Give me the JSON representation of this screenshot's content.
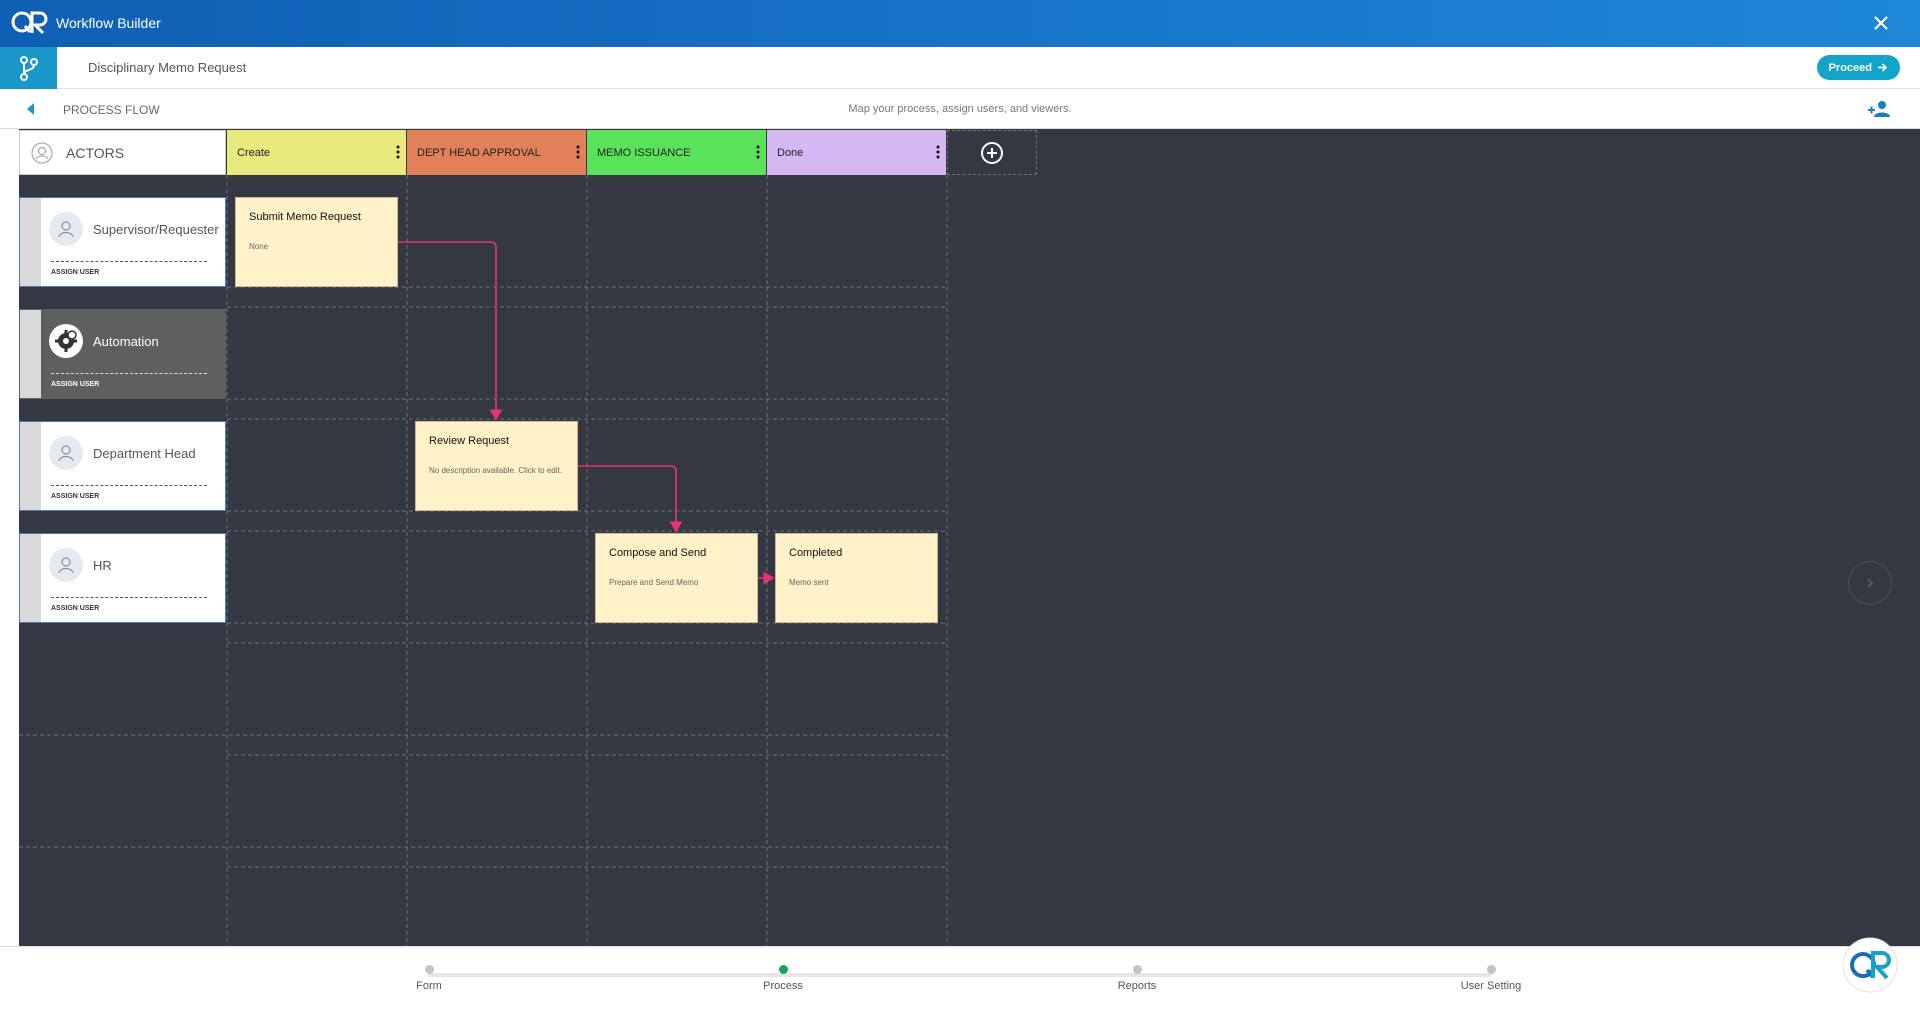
{
  "app": {
    "title": "Workflow Builder"
  },
  "header": {
    "document_title": "Disciplinary Memo Request",
    "proceed_label": "Proceed"
  },
  "subheader": {
    "section": "PROCESS FLOW",
    "hint": "Map your process, assign users, and viewers."
  },
  "lanes": {
    "actors_label": "ACTORS",
    "columns": [
      {
        "label": "Create",
        "color": "#e9ea7d"
      },
      {
        "label": "DEPT HEAD APPROVAL",
        "color": "#e2805a"
      },
      {
        "label": "MEMO ISSUANCE",
        "color": "#5be25b"
      },
      {
        "label": "Done",
        "color": "#d4b8f2"
      }
    ]
  },
  "actors": [
    {
      "name": "Supervisor/Requester",
      "assign_label": "ASSIGN USER"
    },
    {
      "name": "Automation",
      "assign_label": "ASSIGN USER"
    },
    {
      "name": "Department Head",
      "assign_label": "ASSIGN USER"
    },
    {
      "name": "HR",
      "assign_label": "ASSIGN USER"
    }
  ],
  "nodes": [
    {
      "title": "Submit Memo Request",
      "description": "None"
    },
    {
      "title": "Review Request",
      "description": "No description available. Click to edit."
    },
    {
      "title": "Compose and Send",
      "description": "Prepare and Send Memo"
    },
    {
      "title": "Completed",
      "description": "Memo sent"
    }
  ],
  "connector_color": "#e8336e",
  "footer": {
    "steps": [
      {
        "label": "Form",
        "active": false
      },
      {
        "label": "Process",
        "active": true
      },
      {
        "label": "Reports",
        "active": false
      },
      {
        "label": "User Setting",
        "active": false
      }
    ]
  },
  "icons": [
    "logo-icon",
    "close-icon",
    "branch-icon",
    "arrow-right-icon",
    "chevron-left-icon",
    "add-user-icon",
    "avatar-icon",
    "gear-icon",
    "kebab-icon",
    "plus-circle-icon",
    "chevron-right-icon"
  ]
}
